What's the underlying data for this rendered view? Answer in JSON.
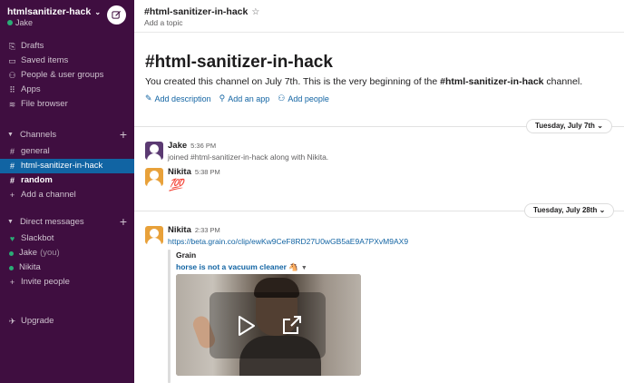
{
  "workspace": {
    "name": "htmlsanitizer-hack",
    "user": "Jake"
  },
  "sidebar": {
    "nav": [
      {
        "label": "Drafts",
        "icon": "drafts-icon"
      },
      {
        "label": "Saved items",
        "icon": "bookmark-icon"
      },
      {
        "label": "People & user groups",
        "icon": "people-icon"
      },
      {
        "label": "Apps",
        "icon": "apps-grid-icon"
      },
      {
        "label": "File browser",
        "icon": "files-icon"
      }
    ],
    "channels_header": "Channels",
    "channels": [
      {
        "label": "general",
        "prefix": "#"
      },
      {
        "label": "html-sanitizer-in-hack",
        "prefix": "#"
      },
      {
        "label": "random",
        "prefix": "#"
      }
    ],
    "add_channel": "Add a channel",
    "dm_header": "Direct messages",
    "dms": [
      {
        "label": "Slackbot",
        "icon": "heart-icon"
      },
      {
        "label": "Jake",
        "suffix": "(you)"
      },
      {
        "label": "Nikita"
      }
    ],
    "invite": "Invite people",
    "upgrade": "Upgrade"
  },
  "header": {
    "channel": "#html-sanitizer-in-hack",
    "topic": "Add a topic"
  },
  "intro": {
    "title": "#html-sanitizer-in-hack",
    "text_before": "You created this channel on July 7th. This is the very beginning of the ",
    "text_channel": "#html-sanitizer-in-hack",
    "text_after": " channel.",
    "links": {
      "description": "Add description",
      "app": "Add an app",
      "people": "Add people"
    }
  },
  "dividers": {
    "first": "Tuesday, July 7th",
    "second": "Tuesday, July 28th"
  },
  "messages": [
    {
      "author": "Jake",
      "time": "5:36 PM",
      "text": "joined #html-sanitizer-in-hack along with Nikita."
    },
    {
      "author": "Nikita",
      "time": "5:38 PM",
      "text": "💯"
    },
    {
      "author": "Nikita",
      "time": "2:33 PM",
      "text": "https://beta.grain.co/clip/ewKw9CeF8RD27U0wGB5aE9A7PXvM9AX9"
    }
  ],
  "attachment": {
    "service": "Grain",
    "title": "horse is not a vacuum cleaner 🐴"
  },
  "colors": {
    "sidebar_bg": "#3f0e40",
    "active_channel": "#1164a3",
    "link": "#1264a3",
    "presence": "#2bac76"
  }
}
